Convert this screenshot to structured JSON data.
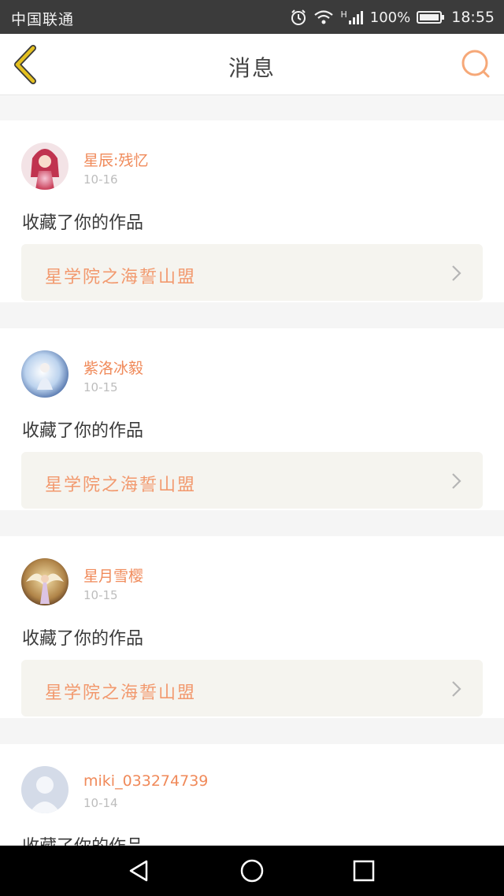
{
  "status_bar": {
    "carrier": "中国联通",
    "signal_label": "H",
    "battery_percent": "100%",
    "time": "18:55",
    "icons": [
      "alarm-icon",
      "wifi-icon",
      "signal-icon",
      "battery-icon"
    ]
  },
  "header": {
    "title": "消息",
    "back_icon": "chevron-left-icon",
    "search_icon": "search-icon",
    "accent_color": "#f6a878",
    "back_color": "#e4c020"
  },
  "messages": [
    {
      "user": "星辰:残忆",
      "date": "10-16",
      "action": "收藏了你的作品",
      "work": "星学院之海誓山盟",
      "avatar": "avatar-pink"
    },
    {
      "user": "紫洛冰毅",
      "date": "10-15",
      "action": "收藏了你的作品",
      "work": "星学院之海誓山盟",
      "avatar": "avatar-blue"
    },
    {
      "user": "星月雪樱",
      "date": "10-15",
      "action": "收藏了你的作品",
      "work": "星学院之海誓山盟",
      "avatar": "avatar-angel"
    },
    {
      "user": "miki_033274739",
      "date": "10-14",
      "action": "收藏了你的作品",
      "work": "",
      "avatar": "avatar-default"
    }
  ],
  "nav_bar": {
    "icons": [
      "back-triangle-icon",
      "home-circle-icon",
      "recents-square-icon"
    ]
  }
}
